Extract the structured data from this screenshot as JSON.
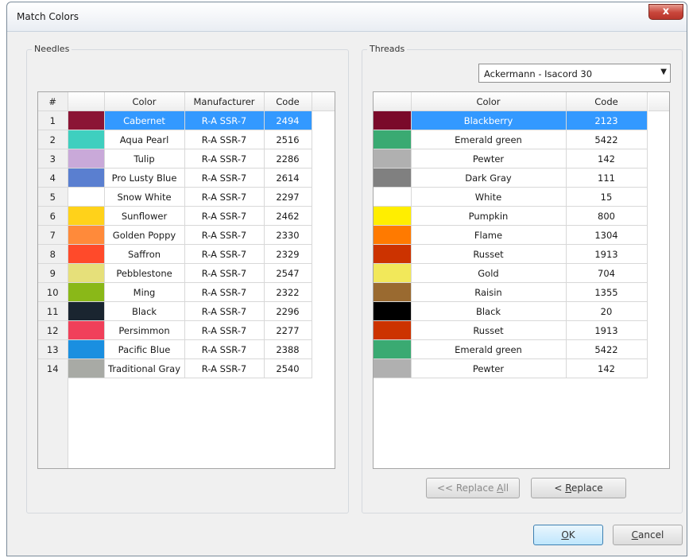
{
  "window": {
    "title": "Match Colors",
    "close_symbol": "x"
  },
  "needles": {
    "label": "Needles",
    "columns": [
      "#",
      "",
      "Color",
      "Manufacturer",
      "Code"
    ],
    "rows": [
      {
        "num": "1",
        "swatch": "#8b1535",
        "color": "Cabernet",
        "manufacturer": "R-A SSR-7",
        "code": "2494",
        "selected": true
      },
      {
        "num": "2",
        "swatch": "#3fcfbf",
        "color": "Aqua Pearl",
        "manufacturer": "R-A SSR-7",
        "code": "2516"
      },
      {
        "num": "3",
        "swatch": "#c9a9d9",
        "color": "Tulip",
        "manufacturer": "R-A SSR-7",
        "code": "2286"
      },
      {
        "num": "4",
        "swatch": "#5a7fd0",
        "color": "Pro Lusty Blue",
        "manufacturer": "R-A SSR-7",
        "code": "2614"
      },
      {
        "num": "5",
        "swatch": "#ffffff",
        "color": "Snow White",
        "manufacturer": "R-A SSR-7",
        "code": "2297"
      },
      {
        "num": "6",
        "swatch": "#ffd21a",
        "color": "Sunflower",
        "manufacturer": "R-A SSR-7",
        "code": "2462"
      },
      {
        "num": "7",
        "swatch": "#ff8a3a",
        "color": "Golden Poppy",
        "manufacturer": "R-A SSR-7",
        "code": "2330"
      },
      {
        "num": "8",
        "swatch": "#ff4a2a",
        "color": "Saffron",
        "manufacturer": "R-A SSR-7",
        "code": "2329"
      },
      {
        "num": "9",
        "swatch": "#e6e07a",
        "color": "Pebblestone",
        "manufacturer": "R-A SSR-7",
        "code": "2547"
      },
      {
        "num": "10",
        "swatch": "#8ab818",
        "color": "Ming",
        "manufacturer": "R-A SSR-7",
        "code": "2322"
      },
      {
        "num": "11",
        "swatch": "#1a2530",
        "color": "Black",
        "manufacturer": "R-A SSR-7",
        "code": "2296"
      },
      {
        "num": "12",
        "swatch": "#f0405a",
        "color": "Persimmon",
        "manufacturer": "R-A SSR-7",
        "code": "2277"
      },
      {
        "num": "13",
        "swatch": "#1a8fe0",
        "color": "Pacific Blue",
        "manufacturer": "R-A SSR-7",
        "code": "2388"
      },
      {
        "num": "14",
        "swatch": "#a8aaa5",
        "color": "Traditional Gray",
        "manufacturer": "R-A SSR-7",
        "code": "2540"
      }
    ]
  },
  "threads": {
    "label": "Threads",
    "dropdown_value": "Ackermann - Isacord 30",
    "columns": [
      "",
      "Color",
      "Code"
    ],
    "rows": [
      {
        "swatch": "#7a0a2a",
        "color": "Blackberry",
        "code": "2123",
        "selected": true
      },
      {
        "swatch": "#3aaa72",
        "color": "Emerald green",
        "code": "5422"
      },
      {
        "swatch": "#b0b0b0",
        "color": "Pewter",
        "code": "142"
      },
      {
        "swatch": "#808080",
        "color": "Dark Gray",
        "code": "111"
      },
      {
        "swatch": "#ffffff",
        "color": "White",
        "code": "15"
      },
      {
        "swatch": "#ffee00",
        "color": "Pumpkin",
        "code": "800"
      },
      {
        "swatch": "#ff7a00",
        "color": "Flame",
        "code": "1304"
      },
      {
        "swatch": "#cc3300",
        "color": "Russet",
        "code": "1913"
      },
      {
        "swatch": "#f2e85a",
        "color": "Gold",
        "code": "704"
      },
      {
        "swatch": "#9a6a30",
        "color": "Raisin",
        "code": "1355"
      },
      {
        "swatch": "#000000",
        "color": "Black",
        "code": "20"
      },
      {
        "swatch": "#cc3300",
        "color": "Russet",
        "code": "1913"
      },
      {
        "swatch": "#3aaa72",
        "color": "Emerald green",
        "code": "5422"
      },
      {
        "swatch": "#b0b0b0",
        "color": "Pewter",
        "code": "142"
      }
    ]
  },
  "buttons": {
    "replace_all_prefix": "<< Replace ",
    "replace_all_mnemonic": "A",
    "replace_all_suffix": "ll",
    "replace_prefix": "< ",
    "replace_mnemonic": "R",
    "replace_suffix": "eplace",
    "ok_mnemonic": "O",
    "ok_suffix": "K",
    "cancel_mnemonic": "C",
    "cancel_suffix": "ancel"
  }
}
